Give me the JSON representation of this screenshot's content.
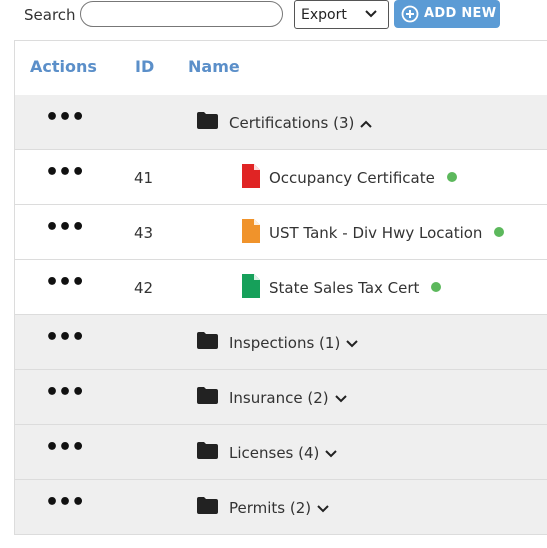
{
  "toolbar": {
    "search_label": "Search",
    "search_value": "",
    "export_value": "Export",
    "add_new_label": "ADD NEW"
  },
  "table": {
    "headers": {
      "actions": "Actions",
      "id": "ID",
      "name": "Name"
    },
    "actions_glyph": "•••",
    "groups": [
      {
        "label": "Certifications (3)",
        "expanded": true,
        "items": [
          {
            "id": "41",
            "name": "Occupancy Certificate",
            "file_color": "#e02424",
            "status_color": "#5cb85c"
          },
          {
            "id": "43",
            "name": "UST Tank - Div Hwy Location",
            "file_color": "#f0932b",
            "status_color": "#5cb85c"
          },
          {
            "id": "42",
            "name": "State Sales Tax Cert",
            "file_color": "#16a05a",
            "status_color": "#5cb85c"
          }
        ]
      },
      {
        "label": "Inspections (1)",
        "expanded": false
      },
      {
        "label": "Insurance (2)",
        "expanded": false
      },
      {
        "label": "Licenses (4)",
        "expanded": false
      },
      {
        "label": "Permits (2)",
        "expanded": false
      }
    ]
  },
  "colors": {
    "accent": "#5b9bd5",
    "header_text": "#5b8fc9",
    "group_bg": "#efefef"
  },
  "icons": {
    "folder": "folder-icon",
    "file": "file-icon",
    "add": "plus-circle-icon",
    "dropdown": "chevron-down-icon"
  }
}
